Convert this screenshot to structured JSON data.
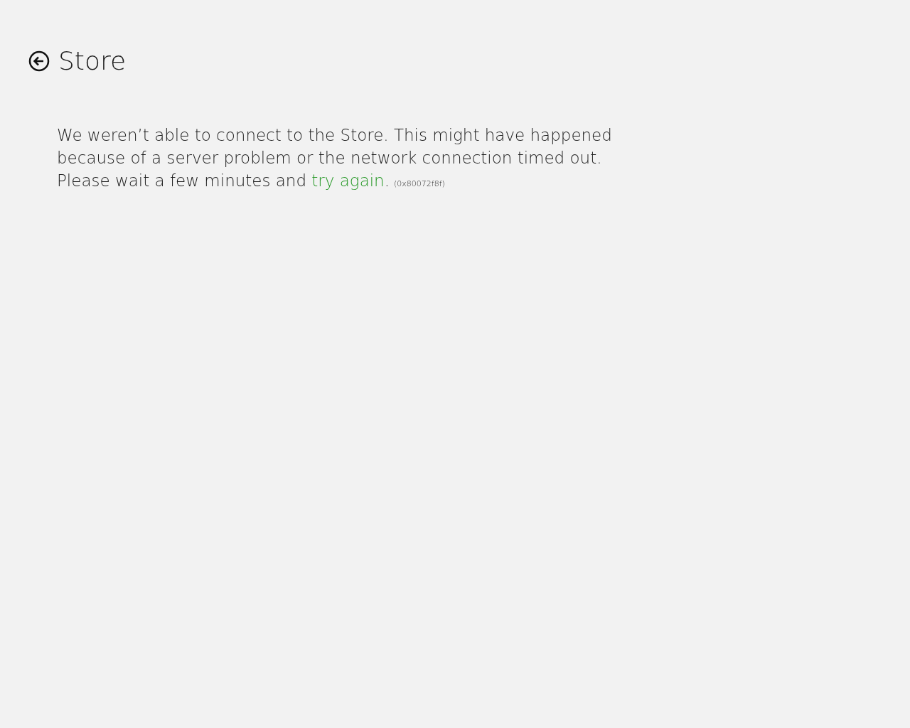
{
  "header": {
    "title": "Store"
  },
  "message": {
    "text": "We weren’t able to connect to the Store. This might have happened because of a server problem or the network connection timed out. Please wait a few minutes and",
    "link": "try again",
    "after_link": ".",
    "error_code": "(0x80072f8f)"
  }
}
